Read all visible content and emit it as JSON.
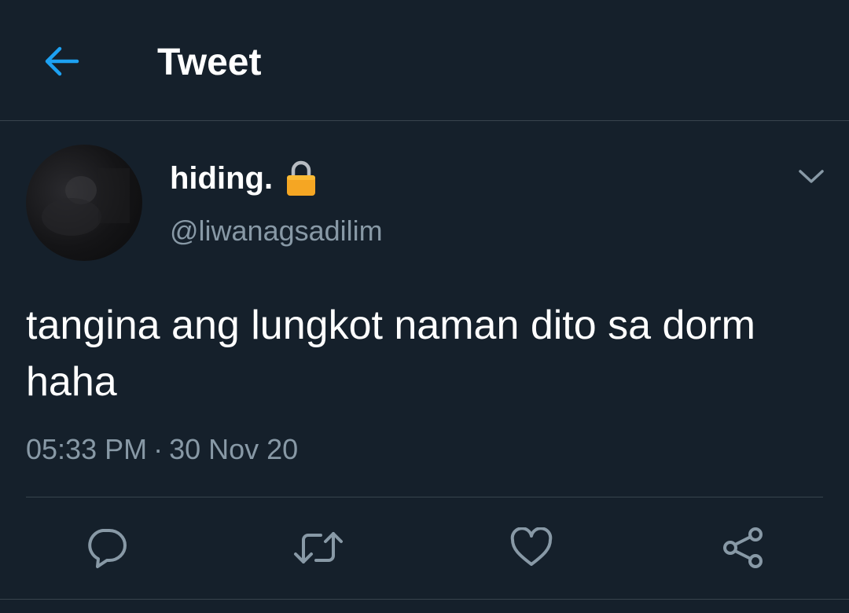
{
  "header": {
    "title": "Tweet",
    "back_icon": "arrow-left-icon",
    "accent_color": "#1da1f2"
  },
  "tweet": {
    "author": {
      "display_name": "hiding.",
      "handle": "@liwanagsadilim",
      "protected_icon": "lock-icon"
    },
    "text": "tangina ang lungkot naman dito sa dorm haha",
    "time": "05:33 PM",
    "separator": "·",
    "date": "30 Nov 20",
    "more_icon": "chevron-down-icon"
  },
  "actions": [
    {
      "name": "reply",
      "icon": "reply-bubble-icon"
    },
    {
      "name": "retweet",
      "icon": "retweet-icon"
    },
    {
      "name": "like",
      "icon": "heart-icon"
    },
    {
      "name": "share",
      "icon": "share-icon"
    }
  ],
  "colors": {
    "background": "#15202b",
    "text_primary": "#ffffff",
    "text_secondary": "#8899a6",
    "divider": "#38444d"
  }
}
